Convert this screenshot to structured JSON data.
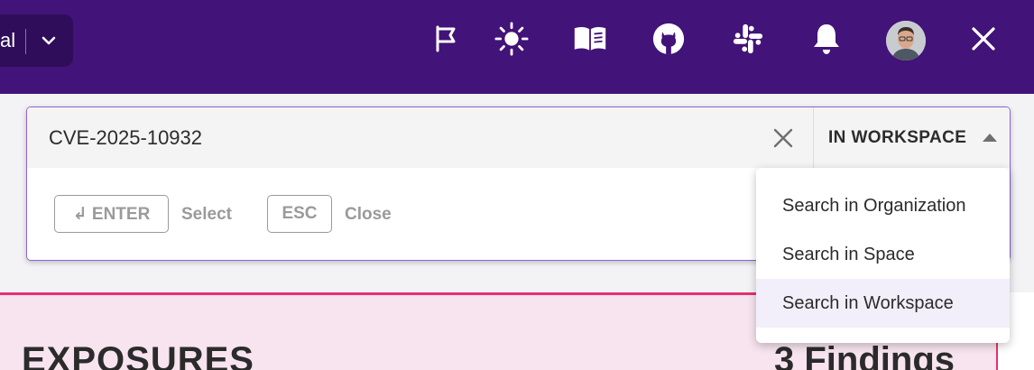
{
  "header": {
    "workspace_name_partial": "al",
    "icons": [
      "flag-icon",
      "theme-sun-icon",
      "docs-book-icon",
      "github-icon",
      "slack-icon",
      "notifications-bell-icon",
      "user-avatar",
      "close-icon"
    ]
  },
  "search": {
    "query": "CVE-2025-10932",
    "scope_label": "IN WORKSPACE",
    "hints": {
      "enter_key": "↲ ENTER",
      "enter_action": "Select",
      "esc_key": "ESC",
      "esc_action": "Close"
    },
    "scope_options": [
      {
        "label": "Search in Organization",
        "selected": false
      },
      {
        "label": "Search in Space",
        "selected": false
      },
      {
        "label": "Search in Workspace",
        "selected": true
      }
    ]
  },
  "background": {
    "section_title": "EXPOSURES",
    "findings_label": "3 Findings"
  },
  "colors": {
    "topbar": "#421378",
    "accent_border": "#8f63d2",
    "exposure_border": "#e3336e",
    "exposure_bg": "#f7e4ee"
  }
}
